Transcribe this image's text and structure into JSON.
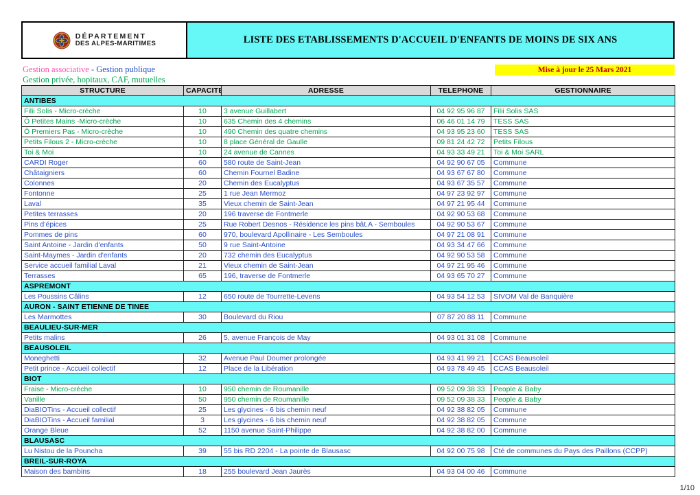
{
  "banner": {
    "logo": {
      "emblem_name": "departement-alpes-maritimes-emblem",
      "line1": "DÉPARTEMENT",
      "line2": "DES ALPES-MARITIMES"
    },
    "title": "LISTE DES ETABLISSEMENTS D'ACCUEIL D'ENFANTS DE MOINS DE SIX ANS"
  },
  "legend": {
    "associative": "Gestion associative",
    "separator": " - ",
    "publique": "Gestion publique",
    "privee": "Gestion privée, hopitaux, CAF, mutuelles",
    "color_associative": "#FF4FB0",
    "color_publique": "#2B50C8",
    "color_privee": "#00A651"
  },
  "update": {
    "text": "Mise à jour le 25 Mars 2021",
    "background": "#FFFF00",
    "color": "#C00000"
  },
  "table": {
    "headers": [
      "STRUCTURE",
      "CAPACITE",
      "ADRESSE",
      "TELEPHONE",
      "GESTIONNAIRE"
    ],
    "header_background": "#D9D9D9",
    "city_background": "#66F7F7",
    "rows": [
      {
        "type": "city",
        "city": "ANTIBES"
      },
      {
        "type": "data",
        "kind": "priv",
        "structure": "Filii Solis - Micro-crèche",
        "capacite": "10",
        "adresse": "3 avenue Guillabert",
        "telephone": "04 92 95 96 87",
        "gestionnaire": "Filii Solis SAS"
      },
      {
        "type": "data",
        "kind": "priv",
        "structure": "Ô Petites Mains -Micro-crèche",
        "capacite": "10",
        "adresse": "635  Chemin des 4 chemins",
        "telephone": "06 46 01 14 79",
        "gestionnaire": "TESS SAS"
      },
      {
        "type": "data",
        "kind": "priv",
        "structure": "Ô Premiers Pas - Micro-crèche",
        "capacite": "10",
        "adresse": "490 Chemin des quatre chemins",
        "telephone": "04 93 95 23 60",
        "gestionnaire": "TESS SAS"
      },
      {
        "type": "data",
        "kind": "priv",
        "structure": "Petits Filous 2 - Micro-crèche",
        "capacite": "10",
        "adresse": "8 place Général de Gaulle",
        "telephone": "09 81 24 42 72",
        "gestionnaire": "Petits Filous"
      },
      {
        "type": "data",
        "kind": "priv",
        "structure": "Toi & Moi",
        "capacite": "10",
        "adresse": "24 avenue de Cannes",
        "telephone": "04 93 33 49 21",
        "gestionnaire": "Toi & Moi SARL"
      },
      {
        "type": "data",
        "kind": "pub",
        "structure": "CARDI  Roger",
        "capacite": "60",
        "adresse": "580 route de Saint-Jean",
        "telephone": "04 92 90 67 05",
        "gestionnaire": "Commune"
      },
      {
        "type": "data",
        "kind": "pub",
        "structure": "Châtaigniers",
        "capacite": "60",
        "adresse": "Chemin Fournel Badine",
        "telephone": "04 93 67 67 80",
        "gestionnaire": "Commune"
      },
      {
        "type": "data",
        "kind": "pub",
        "structure": "Colonnes",
        "capacite": "20",
        "adresse": "Chemin des Eucalyptus",
        "telephone": "04 93 67 35 57",
        "gestionnaire": "Commune"
      },
      {
        "type": "data",
        "kind": "pub",
        "structure": "Fontonne",
        "capacite": "25",
        "adresse": "1 rue Jean Mermoz",
        "telephone": "04 97 23 92 97",
        "gestionnaire": "Commune"
      },
      {
        "type": "data",
        "kind": "pub",
        "structure": "Laval",
        "capacite": "35",
        "adresse": "Vieux chemin de Saint-Jean",
        "telephone": "04 97 21 95 44",
        "gestionnaire": "Commune"
      },
      {
        "type": "data",
        "kind": "pub",
        "structure": "Petites terrasses",
        "capacite": "20",
        "adresse": "196 traverse de Fontmerle",
        "telephone": "04 92 90 53 68",
        "gestionnaire": "Commune"
      },
      {
        "type": "data",
        "kind": "pub",
        "structure": "Pins d’épices",
        "capacite": "25",
        "adresse": "Rue Robert Desnos - Résidence les pins bât.A - Semboules",
        "telephone": "04 92 90 53 67",
        "gestionnaire": "Commune"
      },
      {
        "type": "data",
        "kind": "pub",
        "structure": "Pommes de pins",
        "capacite": "60",
        "adresse": " 970, boulevard Apollinaire - Les Semboules",
        "telephone": "04 97 21 08 91",
        "gestionnaire": "Commune"
      },
      {
        "type": "data",
        "kind": "pub",
        "structure": "Saint Antoine - Jardin d'enfants",
        "capacite": "50",
        "adresse": "9 rue Saint-Antoine",
        "telephone": "04 93 34 47 66",
        "gestionnaire": "Commune"
      },
      {
        "type": "data",
        "kind": "pub",
        "structure": "Saint-Maymes - Jardin d'enfants",
        "capacite": "20",
        "adresse": "732 chemin des Eucalyptus",
        "telephone": "04 92 90 53 58",
        "gestionnaire": "Commune"
      },
      {
        "type": "data",
        "kind": "pub",
        "structure": "Service accueil familial Laval",
        "capacite": "21",
        "adresse": "Vieux chemin de Saint-Jean",
        "telephone": "04 97 21 95 46",
        "gestionnaire": "Commune"
      },
      {
        "type": "data",
        "kind": "pub",
        "structure": "Terrasses",
        "capacite": "65",
        "adresse": "196, traverse de Fontmerle",
        "telephone": "04 93 65 70 27",
        "gestionnaire": "Commune"
      },
      {
        "type": "city",
        "city": "ASPREMONT"
      },
      {
        "type": "data",
        "kind": "pub",
        "structure": "Les Poussins Câlins",
        "capacite": "12",
        "adresse": "650 route de Tourrette-Levens",
        "telephone": "04 93 54 12 53",
        "gestionnaire": "SIVOM Val de Banquière"
      },
      {
        "type": "city",
        "city": "AURON - SAINT ETIENNE DE TINEE"
      },
      {
        "type": "data",
        "kind": "pub",
        "structure": "Les Marmottes",
        "capacite": "30",
        "adresse": "Boulevard du Riou",
        "telephone": "07 87 20 88 11",
        "gestionnaire": "Commune"
      },
      {
        "type": "city",
        "city": "BEAULIEU-SUR-MER"
      },
      {
        "type": "data",
        "kind": "pub",
        "structure": "Petits malins",
        "capacite": "26",
        "adresse": "5, avenue François de May",
        "telephone": "04 93 01 31 08",
        "gestionnaire": "Commune"
      },
      {
        "type": "city",
        "city": "BEAUSOLEIL"
      },
      {
        "type": "data",
        "kind": "pub",
        "structure": "Moneghetti",
        "capacite": "32",
        "adresse": "Avenue Paul Doumer prolongée",
        "telephone": "04 93 41 99 21",
        "gestionnaire": "CCAS Beausoleil"
      },
      {
        "type": "data",
        "kind": "pub",
        "structure": "Petit prince  - Accueil collectif",
        "capacite": "12",
        "adresse": "Place de la Libération",
        "telephone": "04 93 78 49 45",
        "gestionnaire": "CCAS Beausoleil"
      },
      {
        "type": "city",
        "city": "BIOT"
      },
      {
        "type": "data",
        "kind": "priv",
        "structure": "Fraise - Micro-crèche",
        "capacite": "10",
        "adresse": "950 chemin de Roumanille",
        "telephone": "09 52  09 38 33",
        "gestionnaire": "People & Baby"
      },
      {
        "type": "data",
        "kind": "priv",
        "structure": "Vanille",
        "capacite": "50",
        "adresse": "950 chemin de Roumanille",
        "telephone": "09 52 09 38 33",
        "gestionnaire": "People & Baby"
      },
      {
        "type": "data",
        "kind": "pub",
        "structure": "DiaBIOTins - Accueil collectif",
        "capacite": "25",
        "adresse": "Les glycines - 6 bis chemin neuf",
        "telephone": "04 92 38 82 05",
        "gestionnaire": "Commune"
      },
      {
        "type": "data",
        "kind": "pub",
        "structure": "DiaBIOTins - Accueil familial",
        "capacite": "3",
        "adresse": "Les glycines - 6 bis chemin neuf",
        "telephone": "04 92 38 82 05",
        "gestionnaire": "Commune"
      },
      {
        "type": "data",
        "kind": "pub",
        "structure": "Orange Bleue",
        "capacite": "52",
        "adresse": "1150 avenue Saint-Philippe",
        "telephone": "04 92 38 82 00",
        "gestionnaire": "Commune"
      },
      {
        "type": "city",
        "city": "BLAUSASC"
      },
      {
        "type": "data",
        "kind": "pub",
        "structure": "Lu Nistou de la Pouncha",
        "capacite": "39",
        "adresse": "55 bis RD 2204  - La pointe de Blausasc",
        "telephone": "04 92 00 75 98",
        "gestionnaire": "Cté de communes du Pays des Paillons (CCPP)"
      },
      {
        "type": "city",
        "city": "BREIL-SUR-ROYA"
      },
      {
        "type": "data",
        "kind": "pub",
        "structure": "Maison des bambins",
        "capacite": "18",
        "adresse": "255 boulevard Jean Jaurès",
        "telephone": "04 93 04 00 46",
        "gestionnaire": "Commune"
      }
    ]
  },
  "footer": {
    "page": "1/10"
  }
}
